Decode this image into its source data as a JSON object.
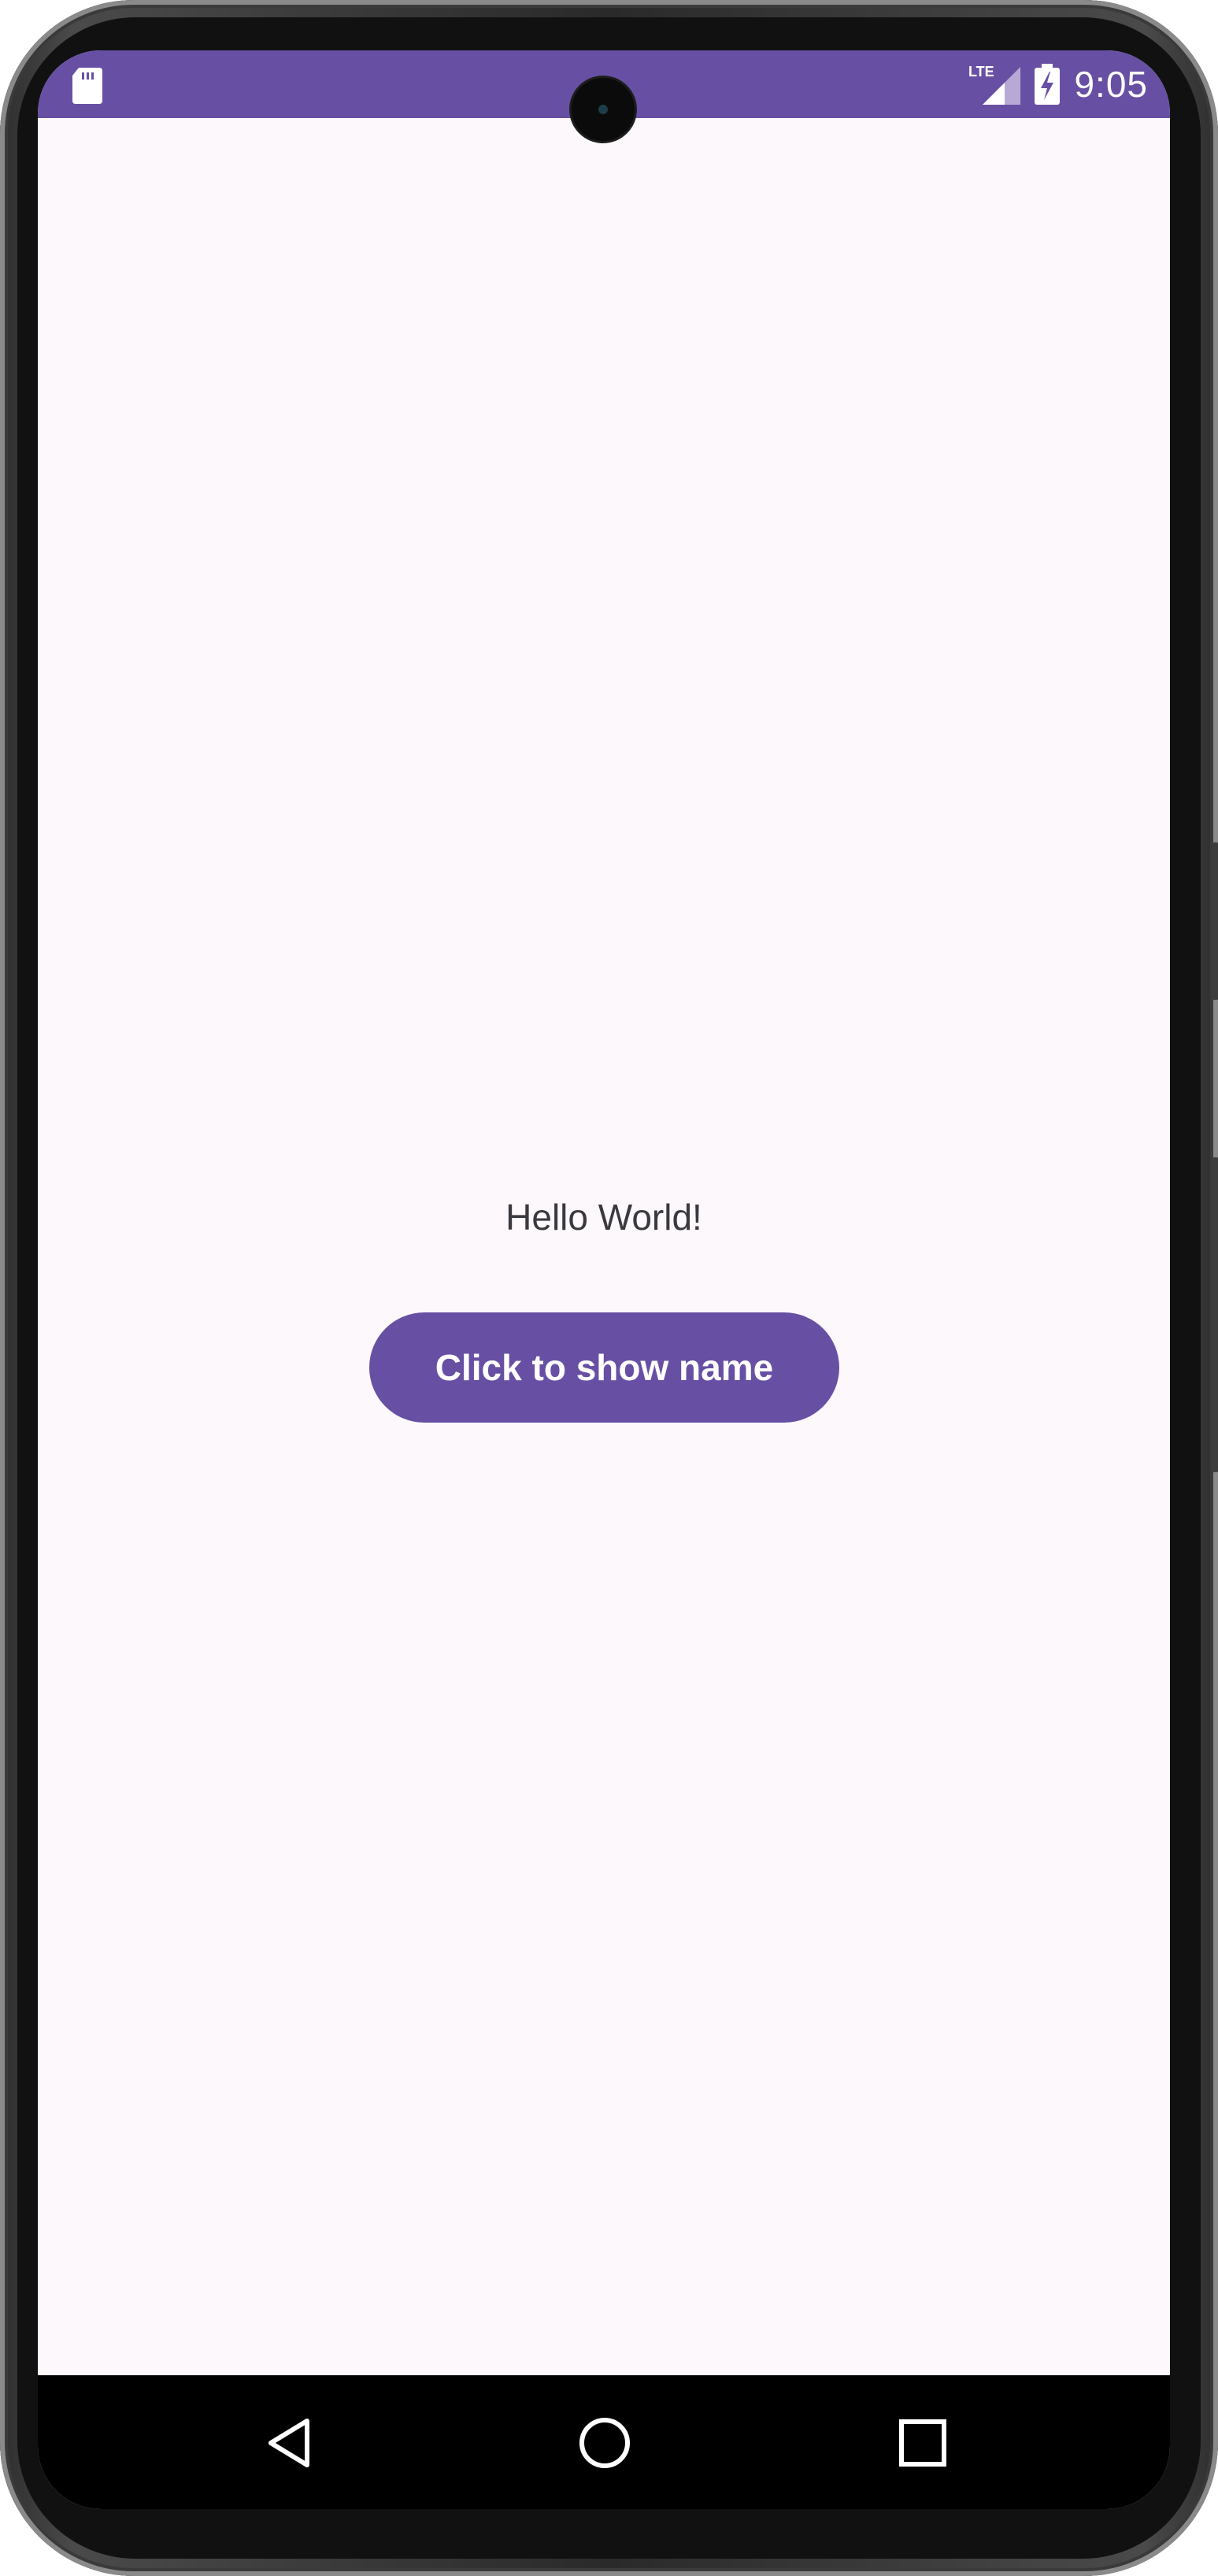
{
  "status_bar": {
    "time": "9:05",
    "network_label": "LTE",
    "background_color": "#6750a4",
    "icons": [
      "sd-card-icon",
      "lte-signal-icon",
      "battery-charging-icon"
    ]
  },
  "main": {
    "greeting": "Hello World!",
    "button_label": "Click to show name",
    "background_color": "#fdf8fb",
    "accent_color": "#6750a4"
  },
  "navigation_bar": {
    "buttons": [
      "back-icon",
      "home-icon",
      "recents-icon"
    ],
    "background_color": "#000000"
  }
}
